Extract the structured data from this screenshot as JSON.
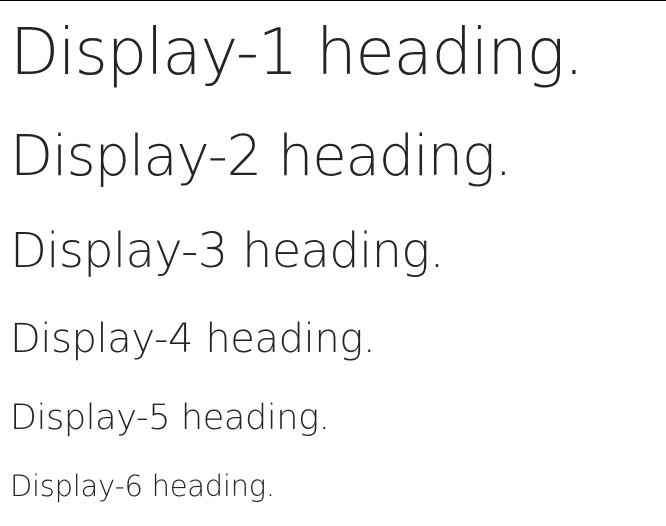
{
  "headings": [
    {
      "text": "Display-1 heading."
    },
    {
      "text": "Display-2 heading."
    },
    {
      "text": "Display-3 heading."
    },
    {
      "text": "Display-4 heading."
    },
    {
      "text": "Display-5 heading."
    },
    {
      "text": "Display-6 heading."
    }
  ],
  "colors": {
    "text": "#212529",
    "background": "#ffffff"
  }
}
